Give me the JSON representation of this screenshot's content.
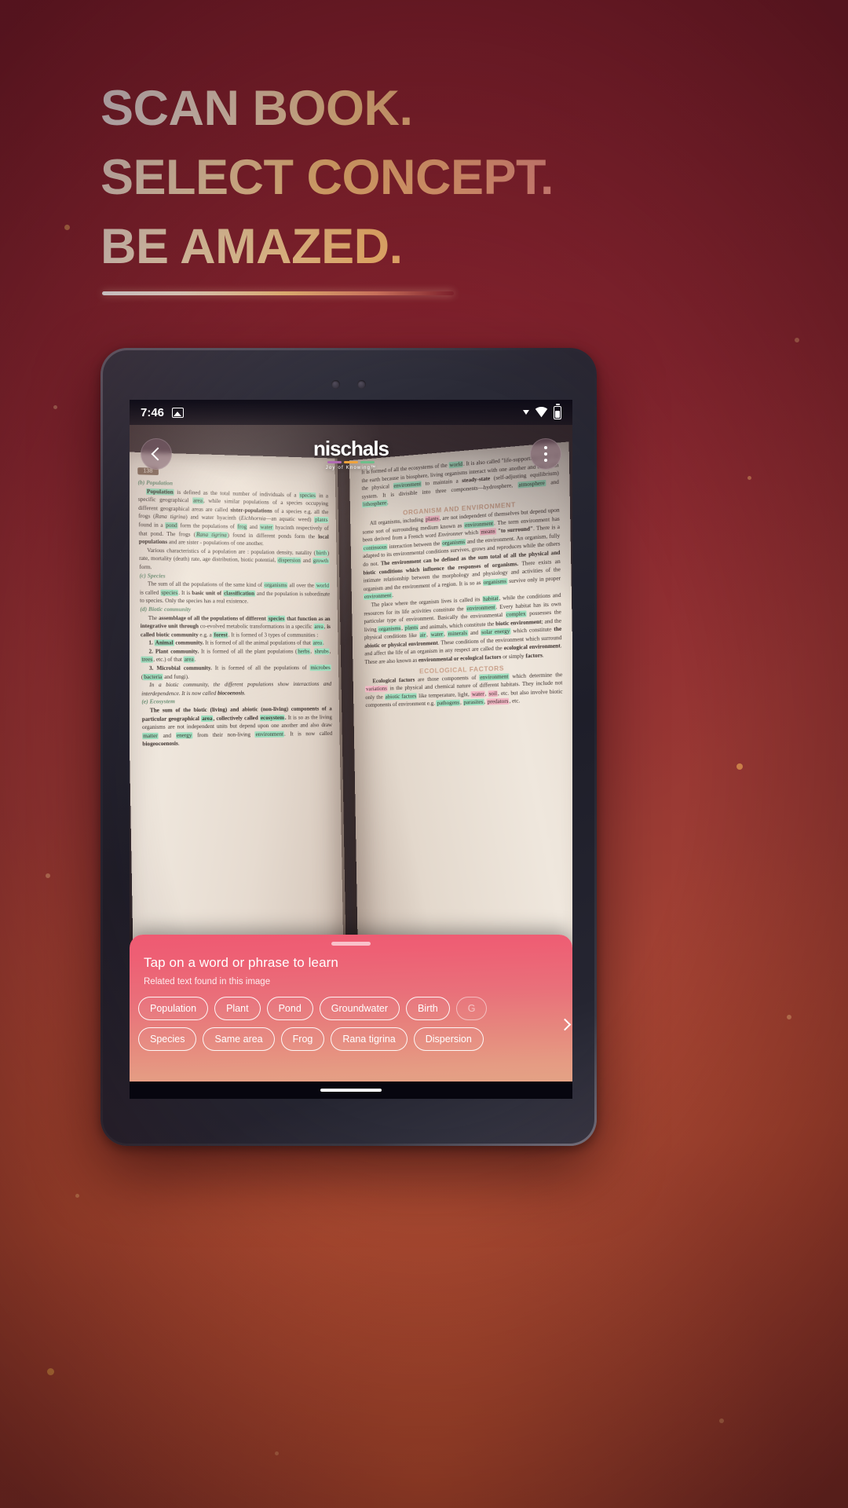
{
  "marketing": {
    "headline_line1": "SCAN BOOK.",
    "headline_line2": "SELECT CONCEPT.",
    "headline_line3": "BE AMAZED.",
    "accent_gradient": [
      "#ffffff",
      "#f3b86f",
      "#ef7f9e"
    ],
    "background_color": "#8a2433"
  },
  "status_bar": {
    "time": "7:46",
    "gallery_icon": "gallery-icon",
    "dropdown_icon": "triangle-down-icon",
    "wifi_icon": "wifi-icon",
    "battery_icon": "battery-icon"
  },
  "app_header": {
    "back_icon": "chevron-left-icon",
    "menu_icon": "overflow-menu-icon",
    "logo_text": "nischals",
    "logo_tagline": "Joy of Knowing™",
    "logo_bar_colors": [
      "#b06ab3",
      "#f0a33c",
      "#6dbf8b"
    ]
  },
  "page_number": "138",
  "book": {
    "left_page": {
      "section_b": "(b) Population",
      "p1": "Population is defined as the total number of individuals of a species in a specific geographical area, while similar populations of a species occupying different geographical areas are called sister-populations of a species e.g. all the frogs (Rana tigrina) and water hyacinth (Eichhornia—an aquatic weed) plants found in a pond form the populations of frog and water hyacinth respectively of that pond. The frogs (Rana tigrina) found in different ponds form the local populations and are sister - populations of one another.",
      "p2": "Various characteristics of a population are : population density, natality (birth) rate, mortality (death) rate, age distribution, biotic potential, dispersion and growth form.",
      "section_c": "(c) Species",
      "p3": "The sum of all the populations of the same kind of organisms all over the world is called species. It is basic unit of classification and the population is subordinate to species. Only the species has a real existence.",
      "section_d": "(d) Biotic community",
      "p4": "The assemblage of all the populations of different species that function as an integrative unit through co-evolved metabolic transformations in a specific area, is called biotic community e.g. a forest. It is formed of 3 types of communities :",
      "p5": "1. Animal community. It is formed of all the animal populations of that area.",
      "p6": "2. Plant community. It is formed of all the plant populations (herbs, shrubs, trees, etc.) of that area.",
      "p7": "3. Microbial community. It is formed of all the populations of microbes (bacteria and fungi).",
      "p8": "In a biotic community, the different populations show interactions and interdependence. It is now called biocoenosis.",
      "section_e": "(e) Ecosystem",
      "p9": "The sum of the biotic (living) and abiotic (non-living) components of a particular geographical area, collectively called ecosystem. It is so as the living organisms are not independent units but depend upon one another and also draw matter and energy from their non-living environment. It is now called biogeocoenosis."
    },
    "right_page": {
      "p1": "It is formed of all the ecosystems of the world. It is also called “life-supporting zone” of the earth because in biosphere, living organisms interact with one another and also with the physical environment to maintain a steady-state (self-adjusting equilibrium) system. It is divisible into three components—hydrosphere, atmosphere and lithosphere.",
      "heading1": "ORGANISM AND ENVIRONMENT",
      "p2": "All organisms, including plants, are not independent of themselves but depend upon some sort of surrounding medium known as environment. The term environment has been derived from a French word Environner which means “to surround”. There is a continuous interaction between the organisms and the environment. An organism, fully adapted to its environmental conditions survives, grows and reproduces while the others do not. The environment can be defined as the sum total of all the physical and biotic conditions which influence the responses of organisms. There exists an intimate relationship between the morphology and physiology and activities of the organism and the environment of a region. It is so as organisms survive only in proper environment.",
      "p3": "The place where the organism lives is called its habitat, while the conditions and resources for its life activities constitute the environment. Every habitat has its own particular type of environment. Basically the environmental complex possesses the living organisms, plants and animals, which constitute the biotic environment; and the physical conditions like air, water, minerals and solar energy which constitute the abiotic or physical environment. These conditions of the environment which surround and affect the life of an organism in any respect are called the ecological environment. These are also known as environmental or ecological factors or simply factors.",
      "heading2": "ECOLOGICAL FACTORS",
      "p4": "Ecological factors are those components of environment which determine the variations in the physical and chemical nature of different habitats. They include not only the abiotic factors like temperature, light, water, soil, etc. but also involve biotic components of environment e.g. pathogens, parasites, predators, etc."
    }
  },
  "sheet": {
    "title": "Tap on a word or phrase to learn",
    "subtitle": "Related text found in this image",
    "handle": "drag-handle",
    "next_icon": "chevron-right-icon",
    "chips_row1": [
      "Population",
      "Plant",
      "Pond",
      "Groundwater",
      "Birth",
      "G"
    ],
    "chips_row2": [
      "Species",
      "Same area",
      "Frog",
      "Rana tigrina",
      "Dispersion"
    ]
  },
  "gesture_bar": "home-indicator"
}
